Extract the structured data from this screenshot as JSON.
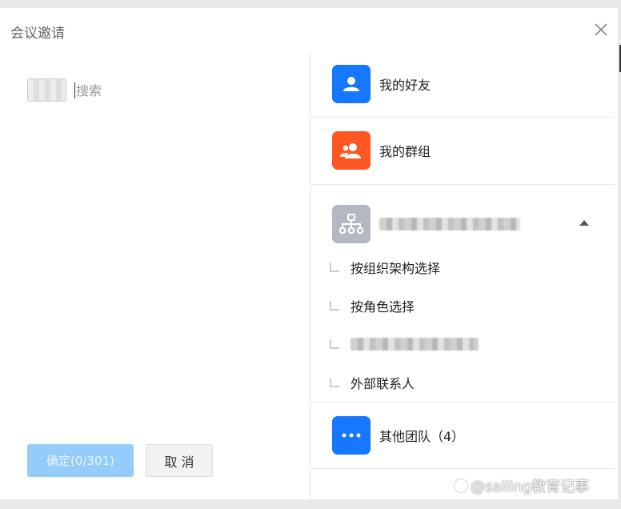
{
  "dialog": {
    "title": "会议邀请",
    "close_icon": "close-icon"
  },
  "left": {
    "search_placeholder": "搜索",
    "confirm_label": "确定(0/301)",
    "cancel_label": "取 消"
  },
  "right": {
    "items": [
      {
        "label": "我的好友",
        "icon": "user-icon",
        "color": "#1677ff"
      },
      {
        "label": "我的群组",
        "icon": "group-icon",
        "color": "#ff5722"
      },
      {
        "label": "",
        "icon": "org-tree-icon",
        "color": "#b4b8c3"
      }
    ],
    "org_subitems": [
      {
        "label": "按组织架构选择"
      },
      {
        "label": "按角色选择"
      },
      {
        "label": ""
      },
      {
        "label": "外部联系人"
      }
    ],
    "other_teams": {
      "label": "其他团队（4）",
      "icon": "more-icon",
      "color": "#1677ff"
    }
  },
  "watermark": "@sailing教育记事",
  "colors": {
    "accent": "#1677ff",
    "confirm_disabled": "#94ccfb"
  }
}
